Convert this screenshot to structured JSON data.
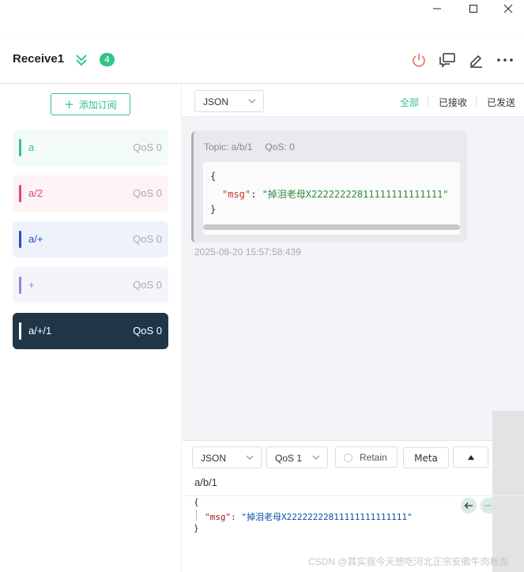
{
  "window": {
    "minimize_glyph": "—",
    "maximize_glyph": "☐",
    "close_glyph": "✕"
  },
  "header": {
    "connection_name": "Receive1",
    "badge_count": "4",
    "icons": [
      "power-icon",
      "chat-icon",
      "edit-icon",
      "more-icon"
    ]
  },
  "sidebar": {
    "add_label": "添加订阅",
    "items": [
      {
        "topic": "a",
        "qos": "QoS 0",
        "color": "#34c388",
        "bg": "#f2fbf7",
        "text": "#34c388"
      },
      {
        "topic": "a/2",
        "qos": "QoS 0",
        "color": "#e5407a",
        "bg": "#fdf2f5",
        "text": "#e5407a"
      },
      {
        "topic": "a/+",
        "qos": "QoS 0",
        "color": "#2b4cc4",
        "bg": "#eef2fc",
        "text": "#2b4cc4"
      },
      {
        "topic": "+",
        "qos": "QoS 0",
        "color": "#9b7fd6",
        "bg": "#f6f4fb",
        "text": "#9b7fd6"
      },
      {
        "topic": "a/+/1",
        "qos": "QoS 0",
        "color": "#ffffff",
        "bg": "#1f3648",
        "text": "#ffffff",
        "selected": true
      }
    ]
  },
  "filter": {
    "format": "JSON",
    "tabs": [
      "全部",
      "已接收",
      "已发送"
    ],
    "active_tab": "全部"
  },
  "message": {
    "topic": "Topic: a/b/1",
    "qos": "QoS: 0",
    "open_brace": "{",
    "key": "\"msg\"",
    "colon": ": ",
    "value": "\"掉泪老母X22222222811111111111111\"",
    "close_brace": "}",
    "time": "2025-08-20 15:57:58:439"
  },
  "composer": {
    "format": "JSON",
    "qos": "QoS 1",
    "retain_label": "Retain",
    "meta_label": "Meta",
    "topic": "a/b/1",
    "open_brace": "{",
    "key": "\"msg\"",
    "colon": ": ",
    "value": "\"掉泪老母X22222222811111111111111\"",
    "close_brace": "}"
  },
  "watermark": "CSDN @其实我今天想吃河北正宗安徽牛肉板面",
  "colors": {
    "accent": "#34c388",
    "selected_bg": "#1f3648"
  }
}
